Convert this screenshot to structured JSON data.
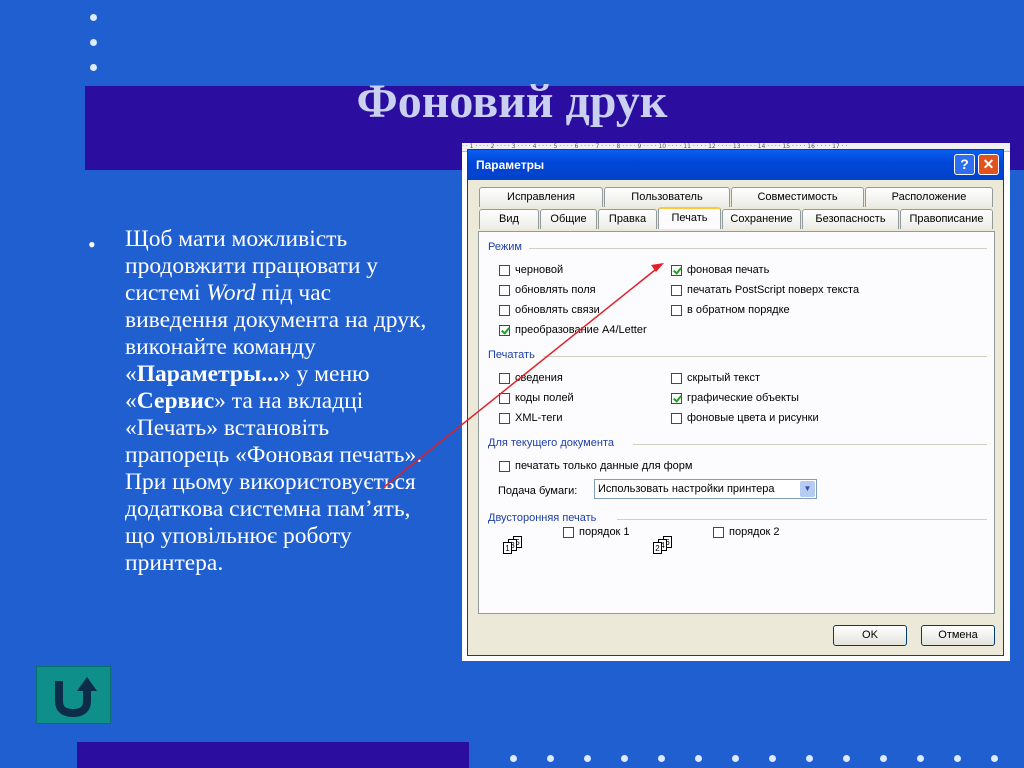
{
  "slide": {
    "title": "Фоновий друк",
    "body_prefix": "Щоб мати можливість продовжити працювати у системі ",
    "body_word": "Word",
    "body_mid1": " під час виведення документа на друк, виконайте команду «",
    "body_cmd": "Параметры...",
    "body_mid2": "» у меню «",
    "body_menu": "Сервис",
    "body_suffix": "» та на вкладці «Печать» встановіть прапорець «Фоновая печать». При цьому використовується додаткова системна пам’ять, що уповільнює роботу принтера.",
    "bullet": "•",
    "back_icon": "back-u-arrow-icon"
  },
  "dialog": {
    "title": "Параметры",
    "help_glyph": "?",
    "close_glyph": "✕",
    "tabs_row1": [
      "Исправления",
      "Пользователь",
      "Совместимость",
      "Расположение"
    ],
    "tabs_row2": [
      "Вид",
      "Общие",
      "Правка",
      "Печать",
      "Сохранение",
      "Безопасность",
      "Правописание"
    ],
    "active_tab": "Печать",
    "groups": {
      "mode": "Режим",
      "print": "Печатать",
      "current_doc": "Для текущего документа",
      "duplex": "Двусторонняя печать"
    },
    "mode_left": [
      {
        "label": "черновой",
        "checked": false
      },
      {
        "label": "обновлять поля",
        "checked": false
      },
      {
        "label": "обновлять связи",
        "checked": false
      },
      {
        "label": "преобразование A4/Letter",
        "checked": true
      }
    ],
    "mode_right": [
      {
        "label": "фоновая печать",
        "checked": true
      },
      {
        "label": "печатать PostScript поверх текста",
        "checked": false
      },
      {
        "label": "в обратном порядке",
        "checked": false
      }
    ],
    "print_left": [
      {
        "label": "сведения",
        "checked": false
      },
      {
        "label": "коды полей",
        "checked": false
      },
      {
        "label": "XML-теги",
        "checked": false
      }
    ],
    "print_right": [
      {
        "label": "скрытый текст",
        "checked": false
      },
      {
        "label": "графические объекты",
        "checked": true
      },
      {
        "label": "фоновые цвета и рисунки",
        "checked": false
      }
    ],
    "form_data_only": {
      "label": "печатать только данные для форм",
      "checked": false
    },
    "paper_feed_label": "Подача бумаги:",
    "paper_feed_value": "Использовать настройки принтера",
    "duplex_front": {
      "label": "порядок 1",
      "checked": false,
      "pages": [
        "1",
        "3",
        "5"
      ]
    },
    "duplex_back": {
      "label": "порядок 2",
      "checked": false,
      "pages": [
        "2",
        "4",
        "6"
      ]
    },
    "ok_label": "OK",
    "cancel_label": "Отмена"
  },
  "colors": {
    "background": "#1f5fcf",
    "band": "#2b0ea0",
    "accent_arrow": "#e0202a"
  }
}
